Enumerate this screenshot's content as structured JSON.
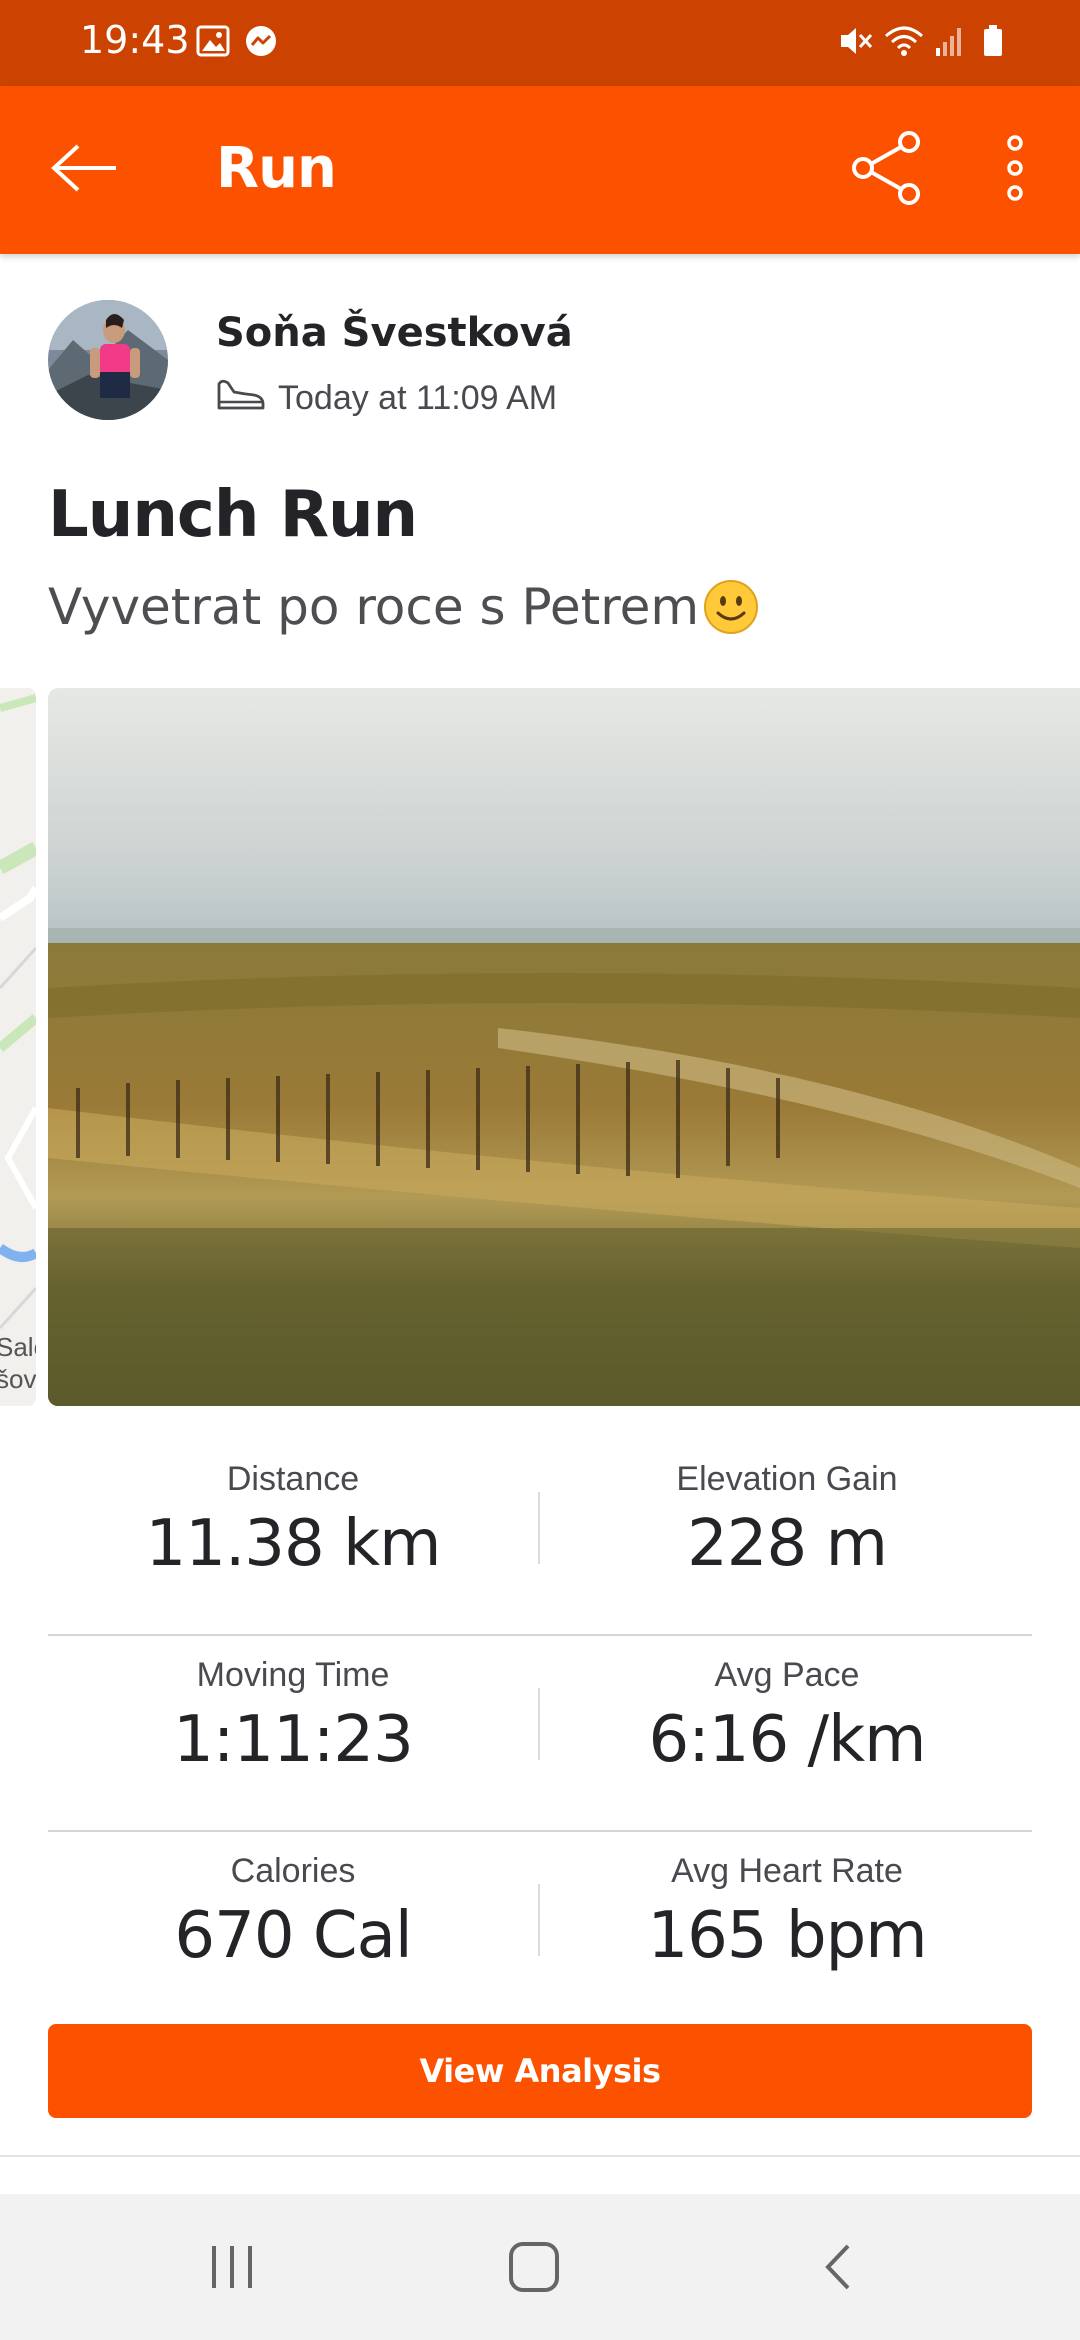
{
  "status_bar": {
    "time": "19:43",
    "left_icons": [
      "gallery-icon",
      "messenger-icon"
    ],
    "right_icons": [
      "mute-icon",
      "wifi-icon",
      "signal-icon",
      "battery-icon"
    ]
  },
  "app_bar": {
    "title": "Run",
    "back_icon": "arrow-left-icon",
    "share_icon": "share-icon",
    "menu_icon": "more-vertical-icon"
  },
  "athlete": {
    "name": "Soňa Švestková",
    "timestamp": "Today at 11:09 AM",
    "activity_icon": "shoe-icon"
  },
  "activity": {
    "title": "Lunch Run",
    "description": "Vyvetrat po roce s Petrem",
    "description_emoji": "smiley-icon"
  },
  "stats": [
    {
      "left": {
        "label": "Distance",
        "value": "11.38 km"
      },
      "right": {
        "label": "Elevation Gain",
        "value": "228 m"
      }
    },
    {
      "left": {
        "label": "Moving Time",
        "value": "1:11:23"
      },
      "right": {
        "label": "Avg Pace",
        "value": "6:16 /km"
      }
    },
    {
      "left": {
        "label": "Calories",
        "value": "670 Cal"
      },
      "right": {
        "label": "Avg Heart Rate",
        "value": "165 bpm"
      }
    }
  ],
  "map_peek_text": "Salc\nšov",
  "cta": {
    "label": "View Analysis"
  },
  "nav_bar": {
    "recents_icon": "recents-icon",
    "home_icon": "home-icon",
    "back_icon": "back-chevron-icon"
  },
  "colors": {
    "brand": "#fc5200",
    "status_bar": "#cc4200"
  }
}
